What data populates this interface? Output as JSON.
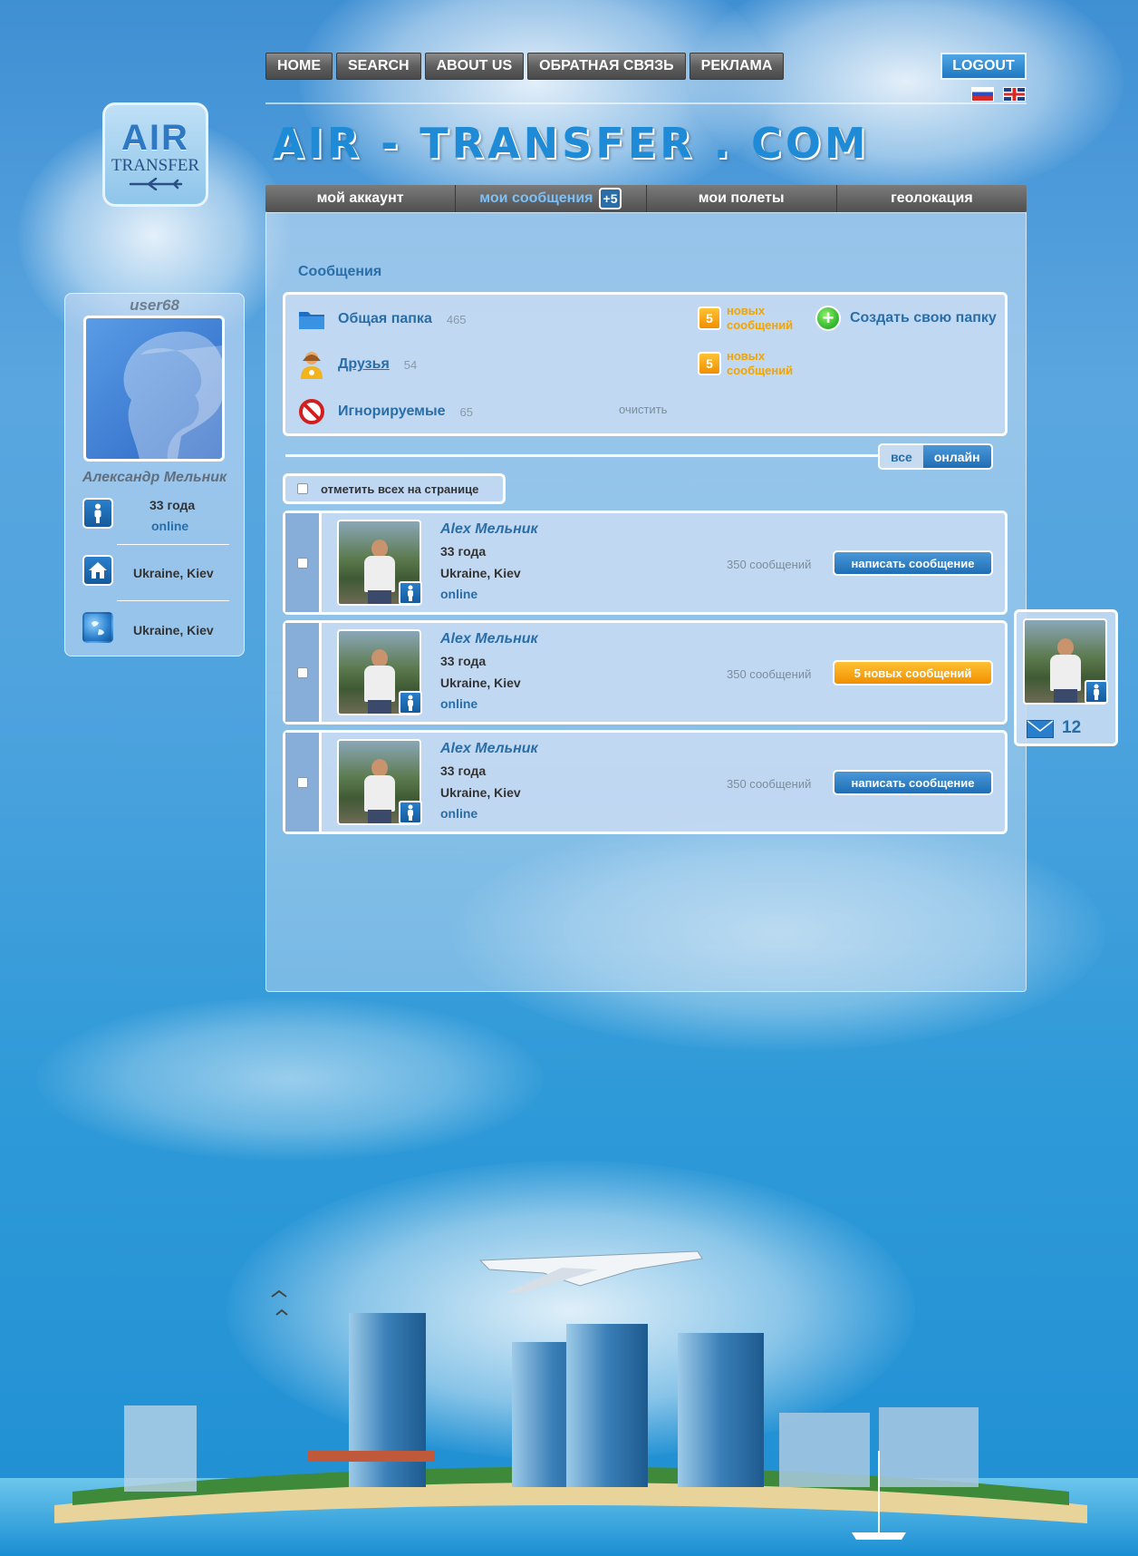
{
  "top_nav": [
    "HOME",
    "SEARCH",
    "ABOUT US",
    "ОБРАТНАЯ СВЯЗЬ",
    "РЕКЛАМА"
  ],
  "logout_label": "LOGOUT",
  "languages": [
    "ru",
    "en"
  ],
  "logo": {
    "line1": "AIR",
    "line2": "TRANSFER"
  },
  "site_title": "AIR - TRANSFER . COM",
  "tabs": [
    {
      "label": "мой аккаунт"
    },
    {
      "label": "мои сообщения",
      "badge": "+5",
      "active": true
    },
    {
      "label": "мои полеты"
    },
    {
      "label": "геолокация"
    }
  ],
  "profile": {
    "username": "user68",
    "full_name": "Александр  Мельник",
    "age": "33 года",
    "status": "online",
    "home_city": "Ukraine, Kiev",
    "location": "Ukraine, Kiev"
  },
  "messages": {
    "title": "Сообщения",
    "folders": [
      {
        "name": "Общая папка",
        "count": "465",
        "new_count": "5",
        "new_label": "новых сообщений",
        "icon": "folder-icon"
      },
      {
        "name": "Друзья",
        "count": "54",
        "new_count": "5",
        "new_label": "новых сообщений",
        "icon": "friends-icon"
      },
      {
        "name": "Игнорируемые",
        "count": "65",
        "action": "очистить",
        "icon": "blocked-icon"
      }
    ],
    "create_folder_label": "Создать свою папку",
    "filter": {
      "all_label": "все",
      "online_label": "онлайн",
      "active": "онлайн"
    },
    "select_all_label": "отметить всех на странице",
    "contacts": [
      {
        "name": "Alex  Мельник",
        "age": "33 года",
        "city": "Ukraine, Kiev",
        "status": "online",
        "messages": "350 сообщений",
        "action": "написать сообщение",
        "action_style": "blue"
      },
      {
        "name": "Alex  Мельник",
        "age": "33 года",
        "city": "Ukraine, Kiev",
        "status": "online",
        "messages": "350 сообщений",
        "action": "5 новых сообщений",
        "action_style": "orange"
      },
      {
        "name": "Alex  Мельник",
        "age": "33 года",
        "city": "Ukraine, Kiev",
        "status": "online",
        "messages": "350 сообщений",
        "action": "написать сообщение",
        "action_style": "blue"
      }
    ]
  },
  "popup": {
    "mail_count": "12"
  },
  "colors": {
    "accent_blue": "#2a6ea8",
    "accent_orange": "#f08f00",
    "nav_gray": "#5e5e5e"
  }
}
